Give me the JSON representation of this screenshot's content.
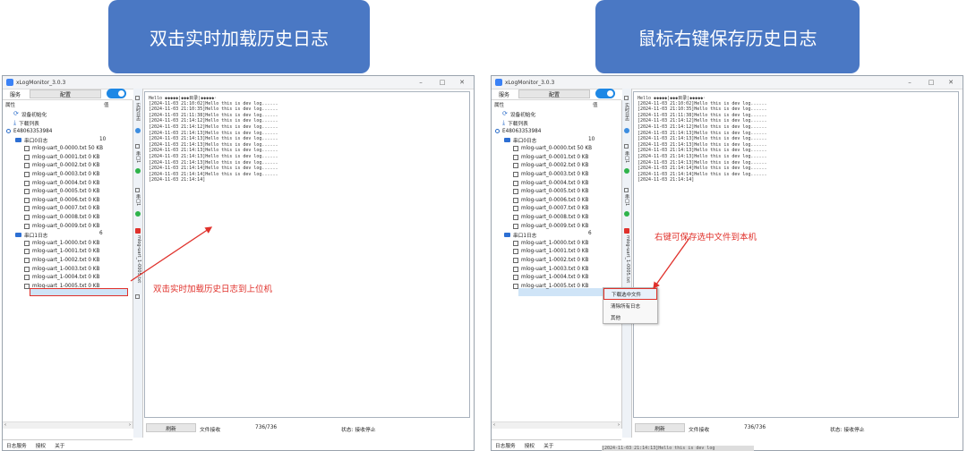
{
  "banners": {
    "left": "双击实时加载历史日志",
    "right": "鼠标右键保存历史日志"
  },
  "window": {
    "title": "xLogMonitor_3.0.3",
    "controls": {
      "minimize": "–",
      "maximize": "□",
      "close": "✕"
    },
    "tabs": {
      "service": "服务",
      "config": "配置"
    },
    "tree": {
      "header": {
        "attr": "属性",
        "value": "值"
      },
      "init": "设备初始化",
      "download": "下载列表",
      "device": "E48063353984",
      "group0": {
        "label": "串口0日志",
        "count": "10"
      },
      "group1": {
        "label": "串口1日志",
        "count": "6"
      },
      "files0": [
        {
          "name": "mlog-uart_0-0000.txt",
          "size": "50 KB"
        },
        {
          "name": "mlog-uart_0-0001.txt",
          "size": "0 KB"
        },
        {
          "name": "mlog-uart_0-0002.txt",
          "size": "0 KB"
        },
        {
          "name": "mlog-uart_0-0003.txt",
          "size": "0 KB"
        },
        {
          "name": "mlog-uart_0-0004.txt",
          "size": "0 KB"
        },
        {
          "name": "mlog-uart_0-0005.txt",
          "size": "0 KB"
        },
        {
          "name": "mlog-uart_0-0006.txt",
          "size": "0 KB"
        },
        {
          "name": "mlog-uart_0-0007.txt",
          "size": "0 KB"
        },
        {
          "name": "mlog-uart_0-0008.txt",
          "size": "0 KB"
        },
        {
          "name": "mlog-uart_0-0009.txt",
          "size": "0 KB"
        }
      ],
      "files1": [
        {
          "name": "mlog-uart_1-0000.txt",
          "size": "0 KB"
        },
        {
          "name": "mlog-uart_1-0001.txt",
          "size": "0 KB"
        },
        {
          "name": "mlog-uart_1-0002.txt",
          "size": "0 KB"
        },
        {
          "name": "mlog-uart_1-0003.txt",
          "size": "0 KB"
        },
        {
          "name": "mlog-uart_1-0004.txt",
          "size": "0 KB"
        },
        {
          "name": "mlog-uart_1-0005.txt",
          "size": "0 KB"
        }
      ]
    },
    "bottom_tabs": {
      "log_service": "日志服务",
      "license": "授权",
      "about": "关于"
    },
    "vtabs": {
      "realtime": "实时日志",
      "uart1": "串口1",
      "file": "mlog-uart_1-0005.txt"
    },
    "log_lines": [
      "Hello ◆◆◆◆◆|◆◆◆目录|◆◆◆◆◆·",
      "[2024-11-03 21:10:02]Hello this is dev log......",
      "[2024-11-03 21:10:35]Hello this is dev log......",
      "[2024-11-03 21:11:38]Hello this is dev log......",
      "[2024-11-03 21:14:12]Hello this is dev log......",
      "[2024-11-03 21:14:12]Hello this is dev log......",
      "[2024-11-03 21:14:13]Hello this is dev log......",
      "[2024-11-03 21:14:13]Hello this is dev log......",
      "[2024-11-03 21:14:13]Hello this is dev log......",
      "[2024-11-03 21:14:13]Hello this is dev log......",
      "[2024-11-03 21:14:13]Hello this is dev log......",
      "[2024-11-03 21:14:13]Hello this is dev log......",
      "[2024-11-03 21:14:14]Hello this is dev log......",
      "[2024-11-03 21:14:14]Hello this is dev log......",
      "[2024-11-03 21:14:14]"
    ],
    "status": {
      "refresh": "刷新",
      "receive_label": "文件接收",
      "progress": "736/736",
      "state": "状态: 接收停止"
    }
  },
  "annotations": {
    "left": "双击实时加载历史日志到上位机",
    "right": "右键可保存选中文件到本机"
  },
  "context_menu": [
    "下载选中文件",
    "清除所有日志",
    "其他"
  ],
  "background_text": "[2024-11-03 21:14:13]Hello this is dev log"
}
